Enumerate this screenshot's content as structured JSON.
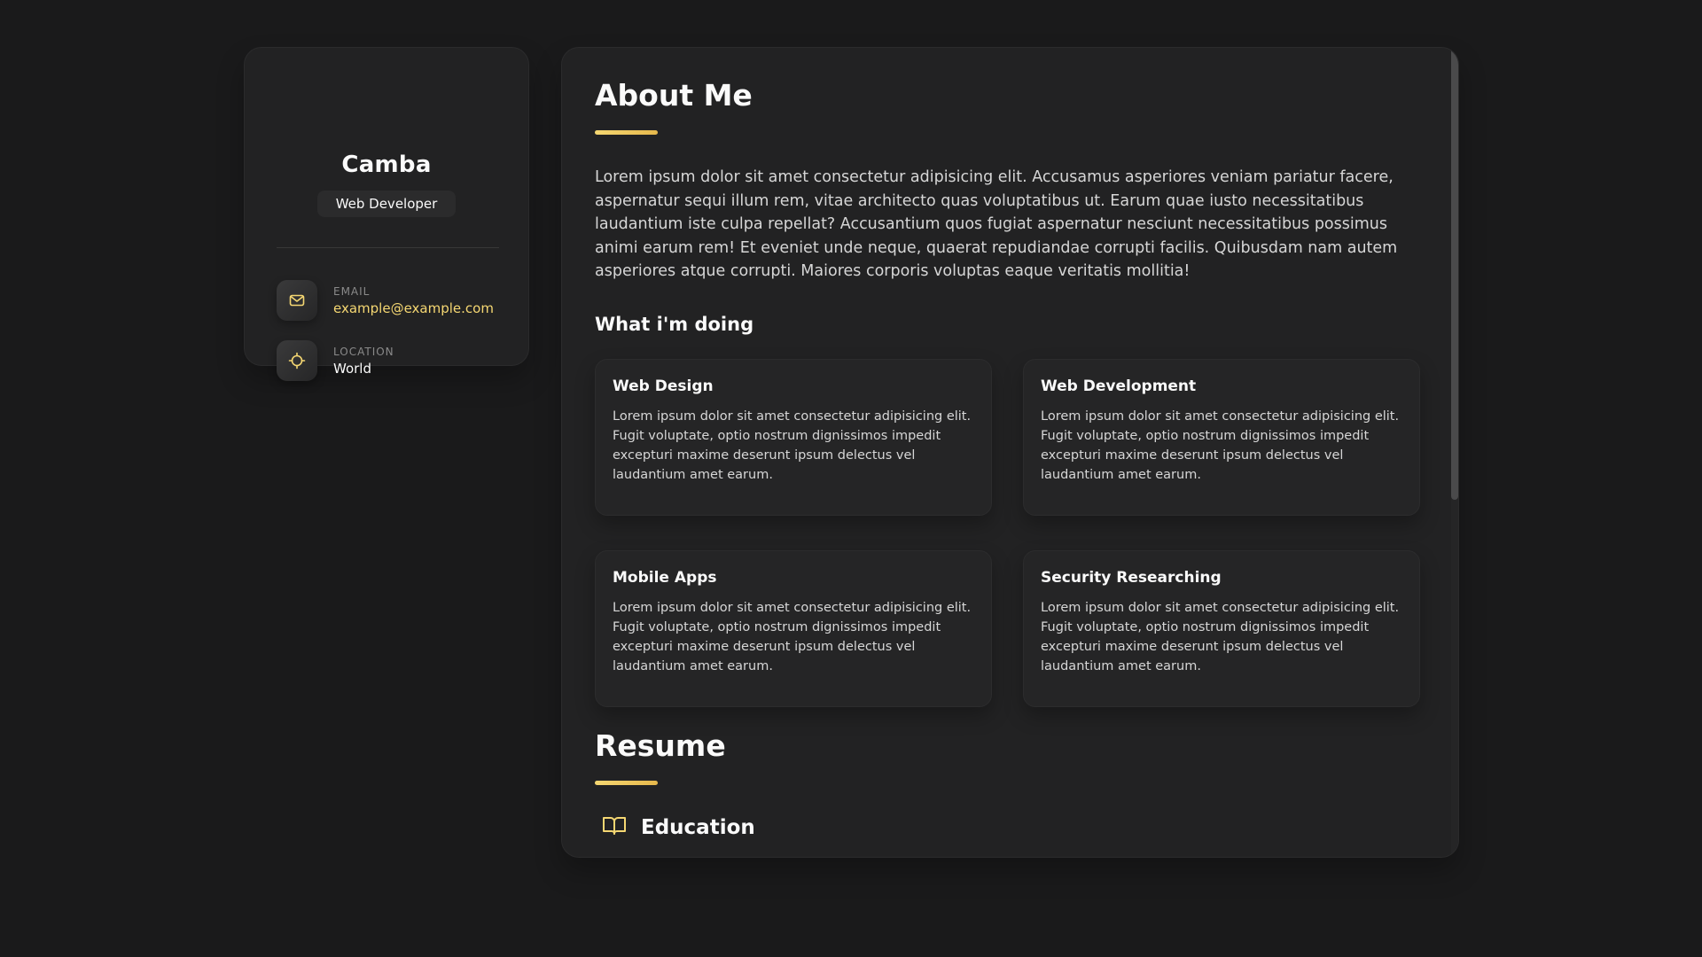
{
  "sidebar": {
    "name": "Camba",
    "title": "Web Developer",
    "contacts": [
      {
        "label": "Email",
        "value": "example@example.com",
        "icon": "mail-icon"
      },
      {
        "label": "Location",
        "value": "World",
        "icon": "crosshair-icon"
      }
    ]
  },
  "about": {
    "heading": "About Me",
    "text": "Lorem ipsum dolor sit amet consectetur adipisicing elit. Accusamus asperiores veniam pariatur facere, aspernatur sequi illum rem, vitae architecto quas voluptatibus ut. Earum quae iusto necessitatibus laudantium iste culpa repellat? Accusantium quos fugiat aspernatur nesciunt necessitatibus possimus animi earum rem! Et eveniet unde neque, quaerat repudiandae corrupti facilis. Quibusdam nam autem asperiores atque corrupti. Maiores corporis voluptas eaque veritatis mollitia!",
    "services_heading": "What i'm doing",
    "services": [
      {
        "title": "Web Design",
        "text": "Lorem ipsum dolor sit amet consectetur adipisicing elit. Fugit voluptate, optio nostrum dignissimos impedit excepturi maxime deserunt ipsum delectus vel laudantium amet earum."
      },
      {
        "title": "Web Development",
        "text": "Lorem ipsum dolor sit amet consectetur adipisicing elit. Fugit voluptate, optio nostrum dignissimos impedit excepturi maxime deserunt ipsum delectus vel laudantium amet earum."
      },
      {
        "title": "Mobile Apps",
        "text": "Lorem ipsum dolor sit amet consectetur adipisicing elit. Fugit voluptate, optio nostrum dignissimos impedit excepturi maxime deserunt ipsum delectus vel laudantium amet earum."
      },
      {
        "title": "Security Researching",
        "text": "Lorem ipsum dolor sit amet consectetur adipisicing elit. Fugit voluptate, optio nostrum dignissimos impedit excepturi maxime deserunt ipsum delectus vel laudantium amet earum."
      }
    ]
  },
  "resume": {
    "heading": "Resume",
    "education": {
      "title": "Education",
      "icon": "book-open-icon"
    }
  },
  "colors": {
    "background": "#1a1a1b",
    "card": "#222223",
    "accent": "#f5d772",
    "text": "#fafafa",
    "muted": "#d6d6d6"
  }
}
